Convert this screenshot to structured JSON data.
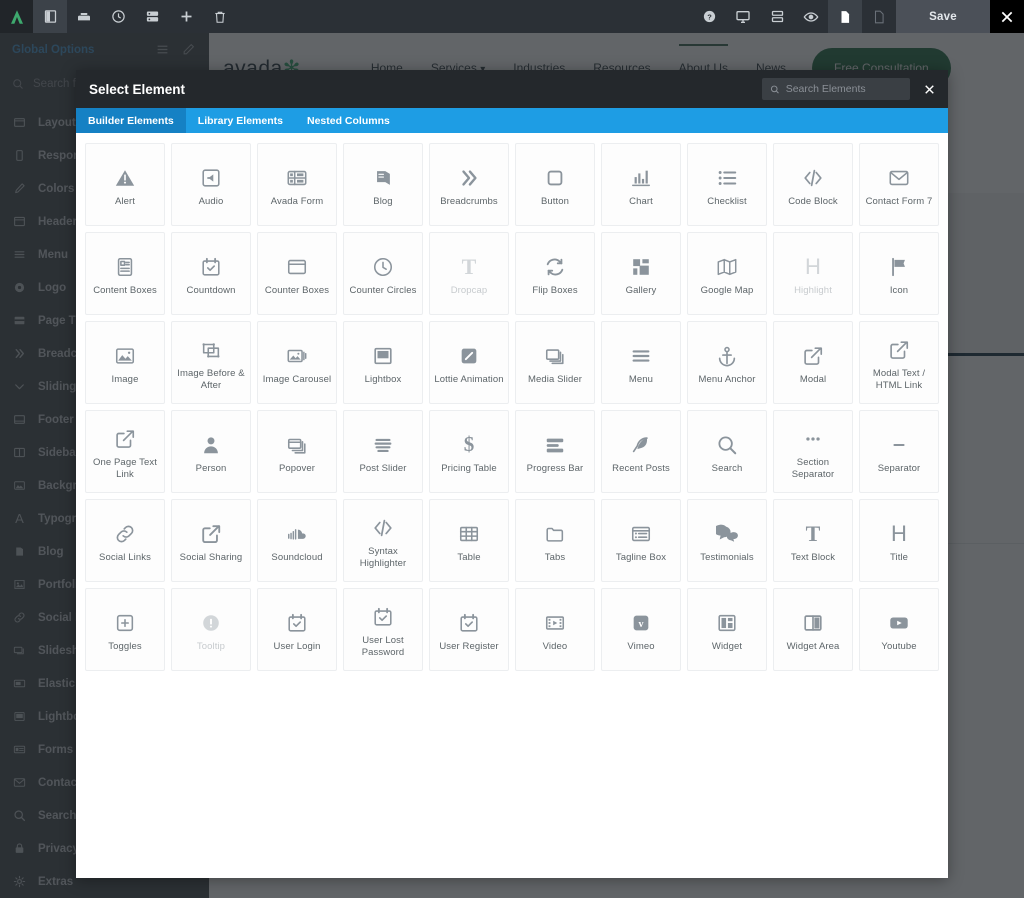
{
  "toolbar": {
    "left_buttons": [
      {
        "name": "avada-logo",
        "icon": "avada-logo-icon"
      },
      {
        "name": "sidebar-toggle",
        "icon": "panel-icon",
        "active": true
      },
      {
        "name": "save-library",
        "icon": "library-icon"
      },
      {
        "name": "history",
        "icon": "clock-icon"
      },
      {
        "name": "layouts",
        "icon": "layers-icon"
      },
      {
        "name": "add-element",
        "icon": "plus-icon"
      },
      {
        "name": "delete",
        "icon": "trash-icon"
      }
    ],
    "right_buttons": [
      {
        "name": "help",
        "icon": "question-circle-icon"
      },
      {
        "name": "desktop-preview",
        "icon": "monitor-icon"
      },
      {
        "name": "layout-view",
        "icon": "rows-icon"
      },
      {
        "name": "preview-toggle",
        "icon": "eye-icon"
      },
      {
        "name": "page-view",
        "icon": "file-filled-icon",
        "active": true
      },
      {
        "name": "draft-view",
        "icon": "file-outline-icon"
      }
    ],
    "save_label": "Save",
    "close_label": "✕"
  },
  "sidebar": {
    "header_title": "Global Options",
    "header_icons": [
      "sliders-icon",
      "pencil-icon"
    ],
    "search_placeholder": "Search for options",
    "items": [
      {
        "label": "Layout",
        "icon": "layout-icon"
      },
      {
        "label": "Responsive",
        "icon": "mobile-icon"
      },
      {
        "label": "Colors",
        "icon": "eyedropper-icon"
      },
      {
        "label": "Header",
        "icon": "header-icon"
      },
      {
        "label": "Menu",
        "icon": "menu-icon"
      },
      {
        "label": "Logo",
        "icon": "circle-dot-icon"
      },
      {
        "label": "Page Title Bar",
        "icon": "page-title-icon"
      },
      {
        "label": "Breadcrumbs",
        "icon": "chevrons-right-icon"
      },
      {
        "label": "Sliding Bar",
        "icon": "chevron-down-icon"
      },
      {
        "label": "Footer",
        "icon": "footer-icon"
      },
      {
        "label": "Sidebars",
        "icon": "sidebars-icon"
      },
      {
        "label": "Background",
        "icon": "background-icon"
      },
      {
        "label": "Typography",
        "icon": "typography-icon"
      },
      {
        "label": "Blog",
        "icon": "blog-icon"
      },
      {
        "label": "Portfolio",
        "icon": "portfolio-icon"
      },
      {
        "label": "Social Media",
        "icon": "link-icon"
      },
      {
        "label": "Slideshows",
        "icon": "slideshow-icon"
      },
      {
        "label": "Elastic Slider",
        "icon": "elastic-slider-icon"
      },
      {
        "label": "Lightbox",
        "icon": "lightbox-icon"
      },
      {
        "label": "Forms",
        "icon": "forms-icon"
      },
      {
        "label": "Contact Form",
        "icon": "envelope-icon"
      },
      {
        "label": "Search",
        "icon": "search-icon"
      },
      {
        "label": "Privacy",
        "icon": "lock-icon"
      },
      {
        "label": "Extras",
        "icon": "gear-icon"
      }
    ]
  },
  "preview": {
    "logo_text": "avada",
    "logo_star": "✻",
    "menu": [
      "Home",
      "Services",
      "Industries",
      "Resources",
      "About Us",
      "News"
    ],
    "menu_active": "About Us",
    "services_caret": "⌄",
    "cta_label": "Free Consultation"
  },
  "modal": {
    "title": "Select Element",
    "search_placeholder": "Search Elements",
    "search_value": "",
    "close_label": "✕",
    "tabs": [
      {
        "label": "Builder Elements",
        "active": true
      },
      {
        "label": "Library Elements",
        "active": false
      },
      {
        "label": "Nested Columns",
        "active": false
      }
    ],
    "elements": [
      {
        "label": "Alert",
        "icon": "alert-triangle-icon",
        "disabled": false
      },
      {
        "label": "Audio",
        "icon": "audio-icon",
        "disabled": false
      },
      {
        "label": "Avada Form",
        "icon": "avada-form-icon",
        "disabled": false
      },
      {
        "label": "Blog",
        "icon": "book-icon",
        "disabled": false
      },
      {
        "label": "Breadcrumbs",
        "icon": "chevrons-right-icon",
        "disabled": false
      },
      {
        "label": "Button",
        "icon": "square-icon",
        "disabled": false
      },
      {
        "label": "Chart",
        "icon": "bar-chart-icon",
        "disabled": false
      },
      {
        "label": "Checklist",
        "icon": "checklist-icon",
        "disabled": false
      },
      {
        "label": "Code Block",
        "icon": "code-icon",
        "disabled": false
      },
      {
        "label": "Contact Form 7",
        "icon": "envelope-icon",
        "disabled": false
      },
      {
        "label": "Content Boxes",
        "icon": "content-boxes-icon",
        "disabled": false
      },
      {
        "label": "Countdown",
        "icon": "calendar-check-icon",
        "disabled": false
      },
      {
        "label": "Counter Boxes",
        "icon": "window-icon",
        "disabled": false
      },
      {
        "label": "Counter Circles",
        "icon": "clock-icon",
        "disabled": false
      },
      {
        "label": "Dropcap",
        "icon": "letter-t-icon",
        "disabled": true
      },
      {
        "label": "Flip Boxes",
        "icon": "refresh-icon",
        "disabled": false
      },
      {
        "label": "Gallery",
        "icon": "gallery-grid-icon",
        "disabled": false
      },
      {
        "label": "Google Map",
        "icon": "map-icon",
        "disabled": false
      },
      {
        "label": "Highlight",
        "icon": "letter-h-icon",
        "disabled": true
      },
      {
        "label": "Icon",
        "icon": "flag-icon",
        "disabled": false
      },
      {
        "label": "Image",
        "icon": "image-icon",
        "disabled": false
      },
      {
        "label": "Image Before & After",
        "icon": "image-compare-icon",
        "disabled": false
      },
      {
        "label": "Image Carousel",
        "icon": "image-carousel-icon",
        "disabled": false
      },
      {
        "label": "Lightbox",
        "icon": "lightbox-icon",
        "disabled": false
      },
      {
        "label": "Lottie Animation",
        "icon": "lottie-icon",
        "disabled": false
      },
      {
        "label": "Media Slider",
        "icon": "media-slider-icon",
        "disabled": false
      },
      {
        "label": "Menu",
        "icon": "menu-bars-icon",
        "disabled": false
      },
      {
        "label": "Menu Anchor",
        "icon": "anchor-icon",
        "disabled": false
      },
      {
        "label": "Modal",
        "icon": "external-link-icon",
        "disabled": false
      },
      {
        "label": "Modal Text / HTML Link",
        "icon": "external-link-icon",
        "disabled": false
      },
      {
        "label": "One Page Text Link",
        "icon": "external-link-icon",
        "disabled": false
      },
      {
        "label": "Person",
        "icon": "person-icon",
        "disabled": false
      },
      {
        "label": "Popover",
        "icon": "popover-icon",
        "disabled": false
      },
      {
        "label": "Post Slider",
        "icon": "post-slider-icon",
        "disabled": false
      },
      {
        "label": "Pricing Table",
        "icon": "dollar-icon",
        "disabled": false
      },
      {
        "label": "Progress Bar",
        "icon": "progress-bar-icon",
        "disabled": false
      },
      {
        "label": "Recent Posts",
        "icon": "feather-icon",
        "disabled": false
      },
      {
        "label": "Search",
        "icon": "search-icon",
        "disabled": false
      },
      {
        "label": "Section Separator",
        "icon": "dots-icon",
        "disabled": false
      },
      {
        "label": "Separator",
        "icon": "dash-icon",
        "disabled": false
      },
      {
        "label": "Social Links",
        "icon": "link-icon",
        "disabled": false
      },
      {
        "label": "Social Sharing",
        "icon": "share-icon",
        "disabled": false
      },
      {
        "label": "Soundcloud",
        "icon": "soundcloud-icon",
        "disabled": false
      },
      {
        "label": "Syntax Highlighter",
        "icon": "code-icon",
        "disabled": false
      },
      {
        "label": "Table",
        "icon": "table-icon",
        "disabled": false
      },
      {
        "label": "Tabs",
        "icon": "folder-icon",
        "disabled": false
      },
      {
        "label": "Tagline Box",
        "icon": "tagline-icon",
        "disabled": false
      },
      {
        "label": "Testimonials",
        "icon": "quote-bubble-icon",
        "disabled": false
      },
      {
        "label": "Text Block",
        "icon": "letter-t-icon",
        "disabled": false
      },
      {
        "label": "Title",
        "icon": "letter-h-icon",
        "disabled": false
      },
      {
        "label": "Toggles",
        "icon": "plus-square-icon",
        "disabled": false
      },
      {
        "label": "Tooltip",
        "icon": "info-circle-icon",
        "disabled": true
      },
      {
        "label": "User Login",
        "icon": "calendar-check-icon",
        "disabled": false
      },
      {
        "label": "User Lost Password",
        "icon": "calendar-check-icon",
        "disabled": false
      },
      {
        "label": "User Register",
        "icon": "calendar-check-icon",
        "disabled": false
      },
      {
        "label": "Video",
        "icon": "film-icon",
        "disabled": false
      },
      {
        "label": "Vimeo",
        "icon": "vimeo-icon",
        "disabled": false
      },
      {
        "label": "Widget",
        "icon": "widget-icon",
        "disabled": false
      },
      {
        "label": "Widget Area",
        "icon": "widget-area-icon",
        "disabled": false
      },
      {
        "label": "Youtube",
        "icon": "youtube-icon",
        "disabled": false
      }
    ]
  },
  "colors": {
    "accent_blue": "#1e9de4",
    "tab_active_blue": "#1581c4",
    "toolbar_dark": "#2b3036",
    "modal_header_dark": "#24282c",
    "sidebar_dark": "#3b4045",
    "cta_green": "#17653c",
    "link_blue": "#3d95d1"
  }
}
